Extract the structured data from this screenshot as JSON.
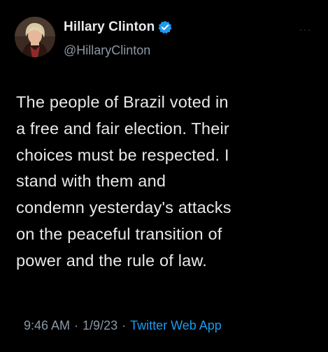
{
  "author": {
    "display_name": "Hillary Clinton",
    "handle": "@HillaryClinton",
    "verified_icon": "verified-badge-icon",
    "avatar_icon": "profile-photo"
  },
  "tweet": {
    "text": "The people of Brazil voted in\na free and fair election. Their\nchoices must be respected. I\nstand with them and\ncondemn yesterday's attacks\non the peaceful transition of\npower and the rule of law."
  },
  "meta": {
    "time": "9:46 AM",
    "separator1": "·",
    "date": "1/9/23",
    "separator2": "·",
    "source": "Twitter Web App"
  },
  "menu": {
    "more_label": "···"
  },
  "colors": {
    "background": "#000000",
    "text": "#e7e9ea",
    "secondary": "#8b98a5",
    "accent": "#1d9bf0"
  }
}
